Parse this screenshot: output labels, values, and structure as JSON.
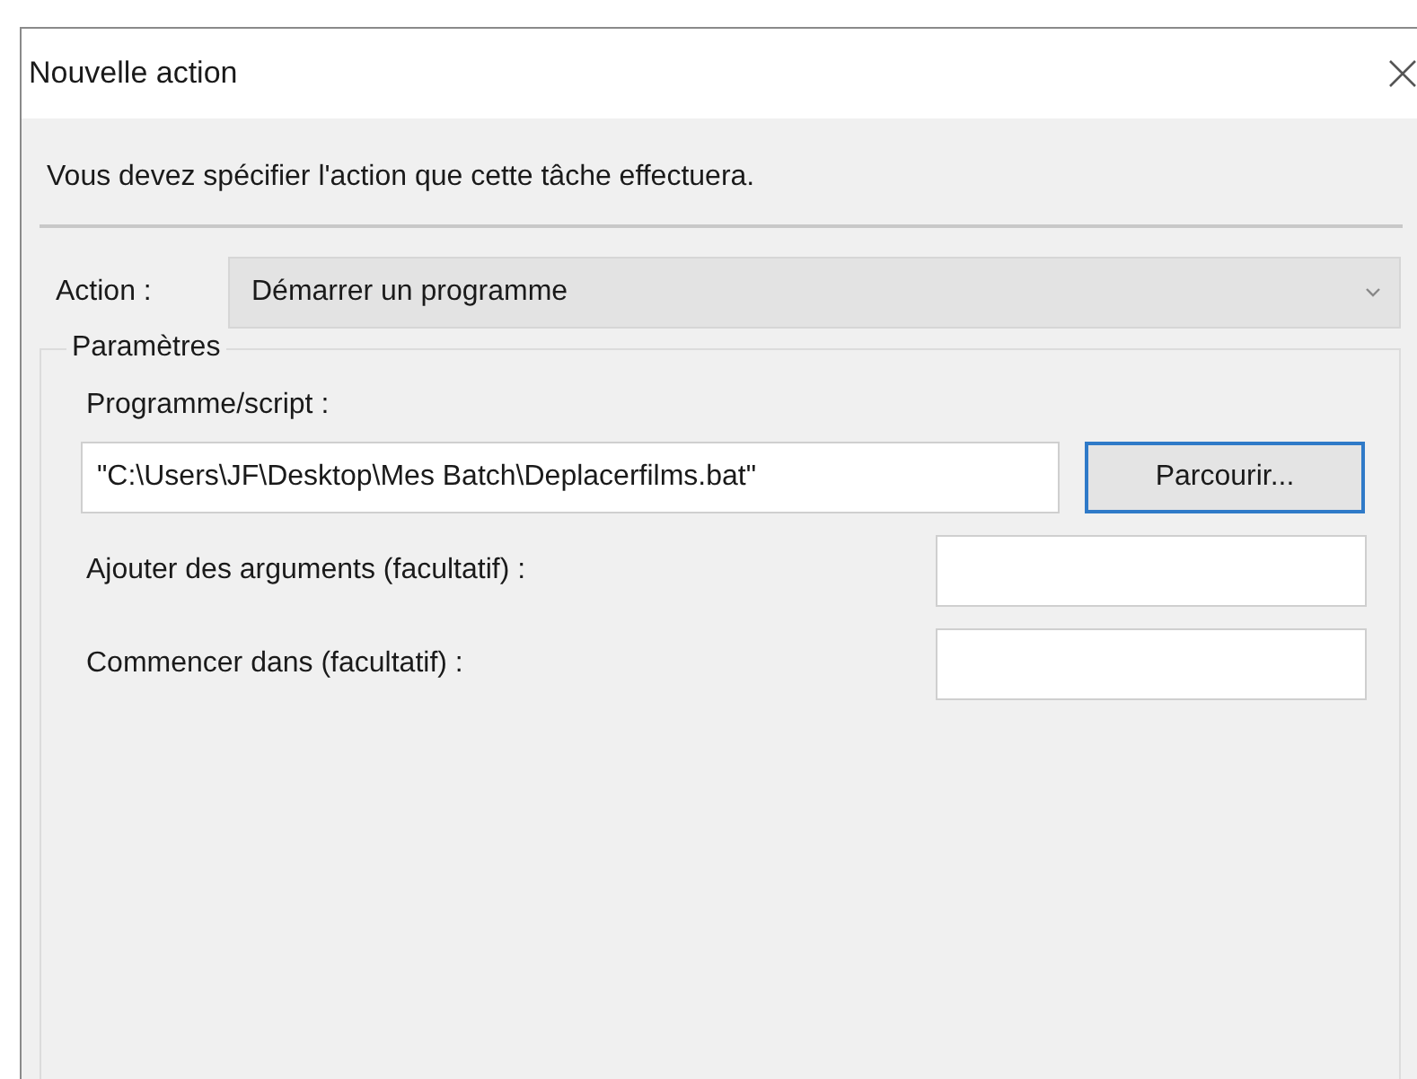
{
  "window": {
    "title": "Nouvelle action"
  },
  "instruction": "Vous devez spécifier l'action que cette tâche effectuera.",
  "action": {
    "label": "Action :",
    "value": "Démarrer un programme"
  },
  "settings": {
    "title": "Paramètres",
    "fields": [
      {
        "kind": "wide",
        "label": "Programme/script :",
        "value": "\"C:\\Users\\JF\\Desktop\\Mes Batch\\Deplacerfilms.bat\"",
        "button": "Parcourir..."
      },
      {
        "kind": "inline",
        "label": "Ajouter des arguments (facultatif) :"
      },
      {
        "kind": "inline",
        "label": "Commencer dans (facultatif) :"
      }
    ]
  }
}
